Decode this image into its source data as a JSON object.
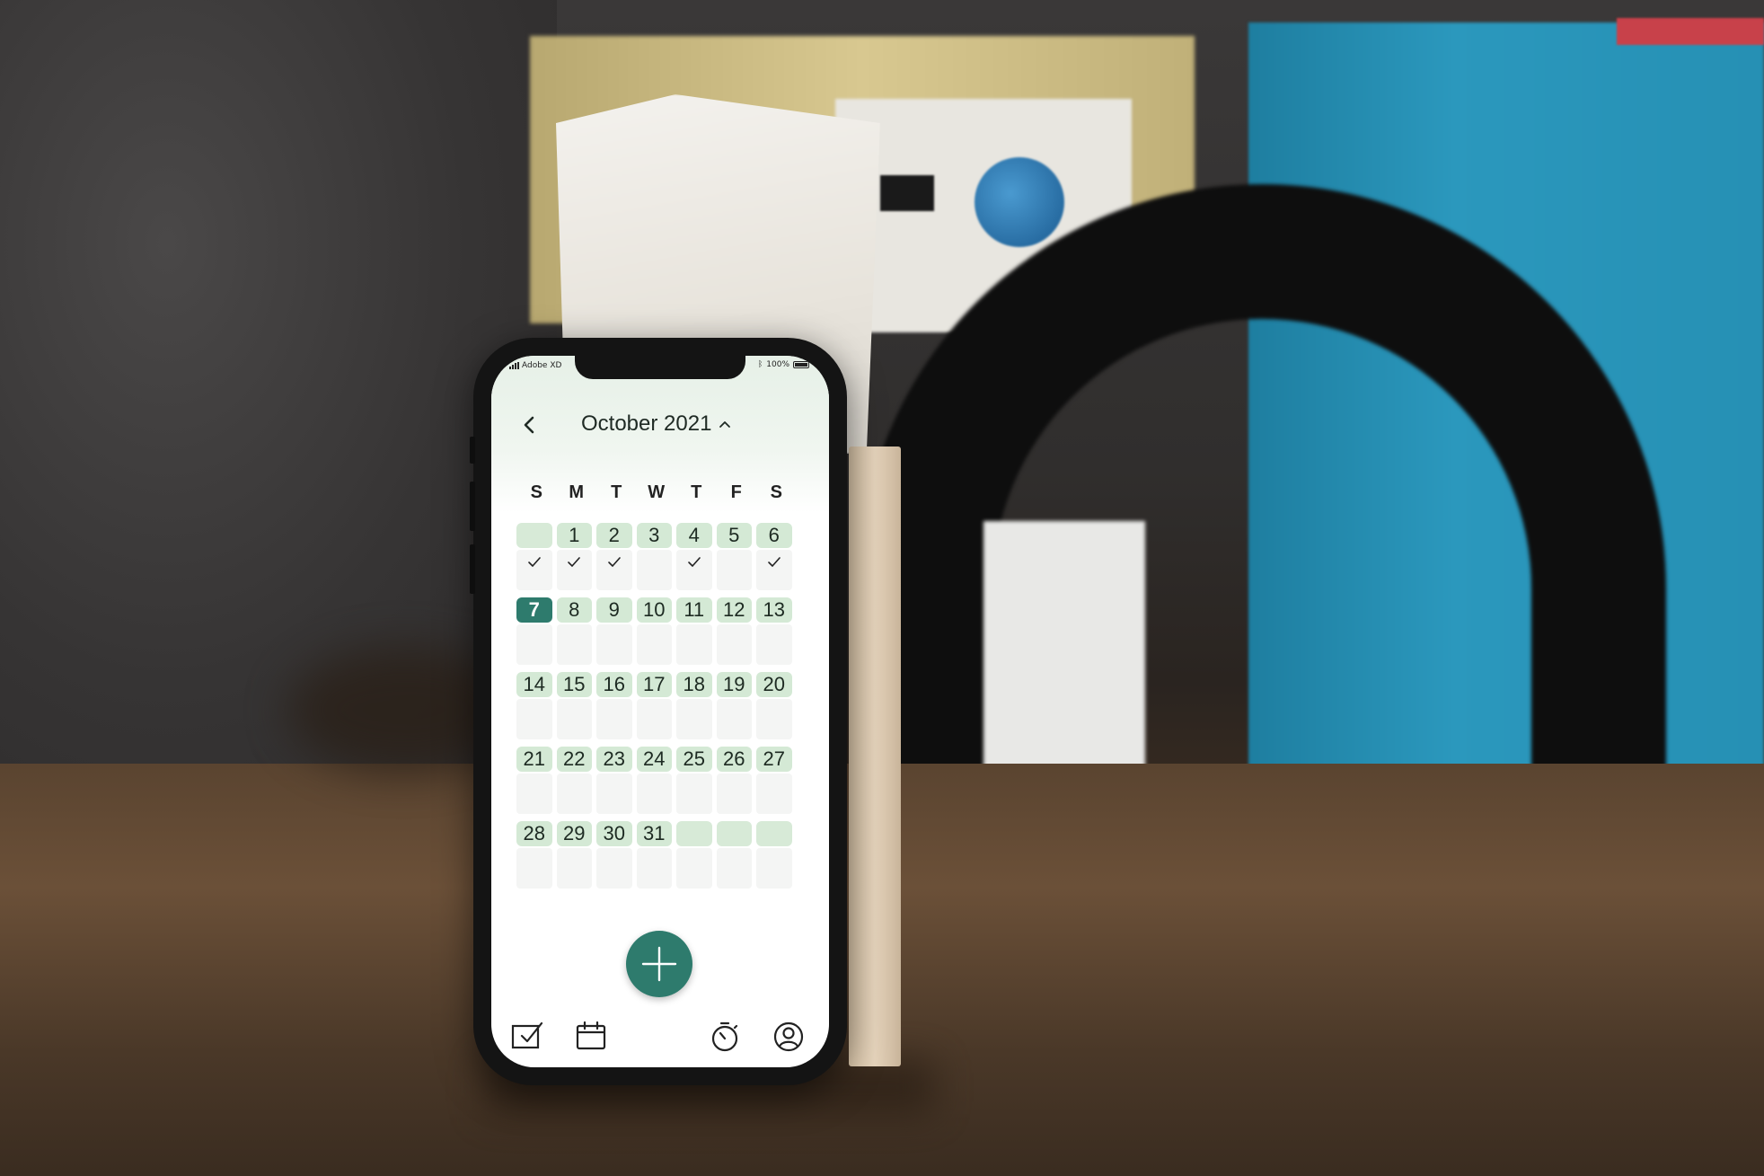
{
  "status_bar": {
    "carrier": "Adobe XD",
    "battery_percent": "100%"
  },
  "calendar": {
    "month_title": "October 2021",
    "weekdays": [
      "S",
      "M",
      "T",
      "W",
      "T",
      "F",
      "S"
    ],
    "weeks": [
      [
        {
          "day": "",
          "check": true
        },
        {
          "day": "1",
          "check": true
        },
        {
          "day": "2",
          "check": true
        },
        {
          "day": "3",
          "check": false
        },
        {
          "day": "4",
          "check": true
        },
        {
          "day": "5",
          "check": false
        },
        {
          "day": "6",
          "check": true
        }
      ],
      [
        {
          "day": "7",
          "check": false,
          "today": true
        },
        {
          "day": "8"
        },
        {
          "day": "9"
        },
        {
          "day": "10"
        },
        {
          "day": "11"
        },
        {
          "day": "12"
        },
        {
          "day": "13"
        }
      ],
      [
        {
          "day": "14"
        },
        {
          "day": "15"
        },
        {
          "day": "16"
        },
        {
          "day": "17"
        },
        {
          "day": "18"
        },
        {
          "day": "19"
        },
        {
          "day": "20"
        }
      ],
      [
        {
          "day": "21"
        },
        {
          "day": "22"
        },
        {
          "day": "23"
        },
        {
          "day": "24"
        },
        {
          "day": "25"
        },
        {
          "day": "26"
        },
        {
          "day": "27"
        }
      ],
      [
        {
          "day": "28"
        },
        {
          "day": "29"
        },
        {
          "day": "30"
        },
        {
          "day": "31"
        },
        {
          "day": ""
        },
        {
          "day": ""
        },
        {
          "day": ""
        }
      ]
    ]
  },
  "navigation": {
    "items": [
      {
        "icon": "checklist-icon"
      },
      {
        "icon": "calendar-icon"
      },
      {
        "icon": "add-icon"
      },
      {
        "icon": "stopwatch-icon"
      },
      {
        "icon": "profile-icon"
      }
    ]
  },
  "colors": {
    "accent": "#2e7b6d",
    "day_cell": "#d4e9d5",
    "cell_body": "#f4f5f4",
    "header_tint": "#e6f0e7"
  }
}
